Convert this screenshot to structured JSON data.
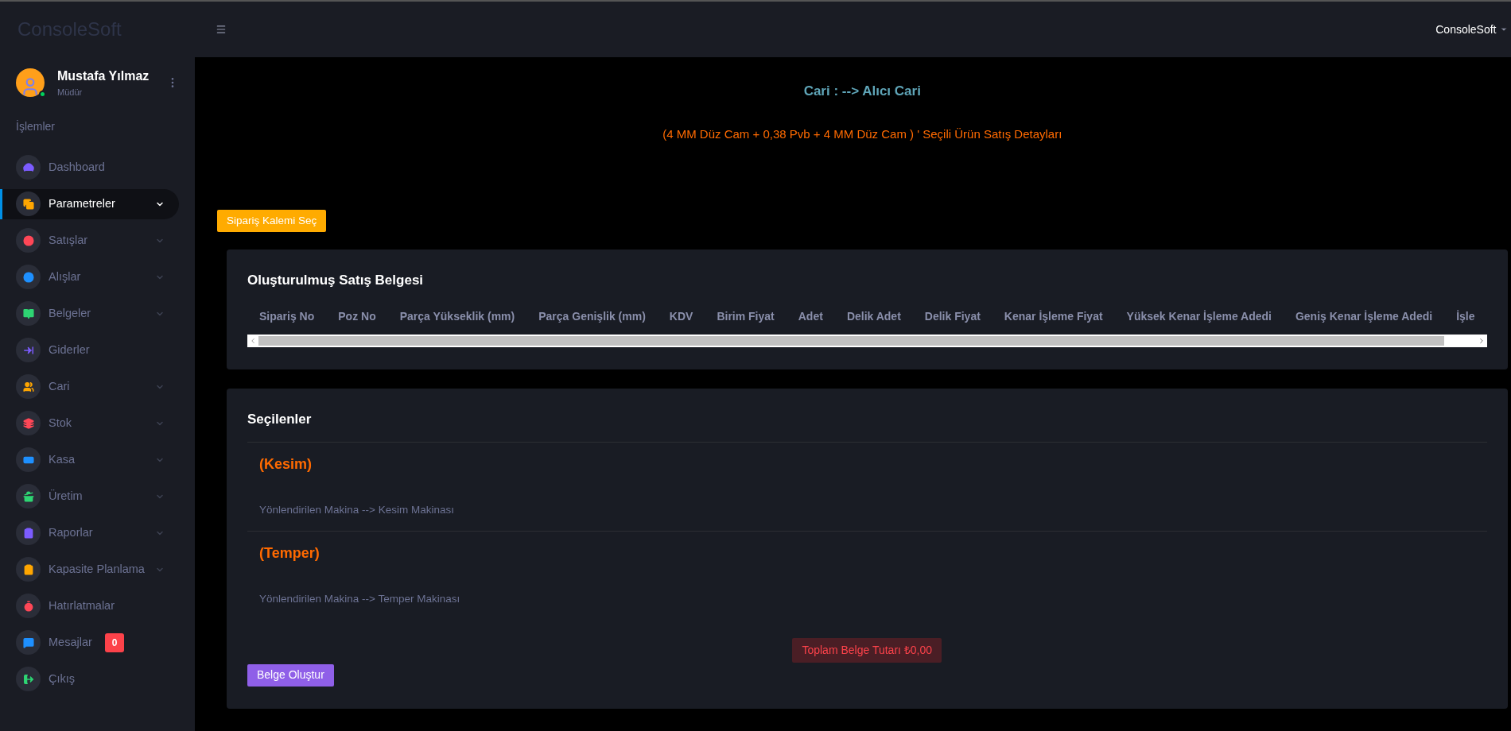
{
  "brand": "ConsoleSoft",
  "topbar": {
    "account": "ConsoleSoft"
  },
  "user": {
    "name": "Mustafa Yılmaz",
    "role": "Müdür",
    "online": true
  },
  "sidebar": {
    "heading": "İşlemler",
    "items": [
      {
        "label": "Dashboard",
        "color": "#7c5cff",
        "expandable": false,
        "selected": false
      },
      {
        "label": "Parametreler",
        "color": "#ffa600",
        "expandable": true,
        "selected": true
      },
      {
        "label": "Satışlar",
        "color": "#ff4757",
        "expandable": true,
        "selected": false
      },
      {
        "label": "Alışlar",
        "color": "#1e90ff",
        "expandable": true,
        "selected": false
      },
      {
        "label": "Belgeler",
        "color": "#2ed573",
        "expandable": true,
        "selected": false
      },
      {
        "label": "Giderler",
        "color": "#7c5cff",
        "expandable": false,
        "selected": false
      },
      {
        "label": "Cari",
        "color": "#ffa600",
        "expandable": true,
        "selected": false
      },
      {
        "label": "Stok",
        "color": "#ff4757",
        "expandable": true,
        "selected": false
      },
      {
        "label": "Kasa",
        "color": "#1e90ff",
        "expandable": true,
        "selected": false
      },
      {
        "label": "Üretim",
        "color": "#2ed573",
        "expandable": true,
        "selected": false
      },
      {
        "label": "Raporlar",
        "color": "#7c5cff",
        "expandable": true,
        "selected": false
      },
      {
        "label": "Kapasite Planlama",
        "color": "#ffa600",
        "expandable": true,
        "selected": false
      },
      {
        "label": "Hatırlatmalar",
        "color": "#ff4757",
        "expandable": false,
        "selected": false
      },
      {
        "label": "Mesajlar",
        "color": "#1e90ff",
        "expandable": false,
        "selected": false,
        "badge": "0"
      },
      {
        "label": "Çıkış",
        "color": "#2ed573",
        "expandable": false,
        "selected": false
      }
    ]
  },
  "header": {
    "title": "Cari : --> Alıcı Cari",
    "subtitle": "(4 MM Düz Cam + 0,38 Pvb + 4 MM Düz Cam ) ' Seçili Ürün Satış Detayları"
  },
  "select_button": "Sipariş Kalemi Seç",
  "document_card": {
    "title": "Oluşturulmuş Satış Belgesi",
    "columns": [
      "Sipariş No",
      "Poz No",
      "Parça Yükseklik (mm)",
      "Parça Genişlik (mm)",
      "KDV",
      "Birim Fiyat",
      "Adet",
      "Delik Adet",
      "Delik Fiyat",
      "Kenar İşleme Fiyat",
      "Yüksek Kenar İşleme Adedi",
      "Geniş Kenar İşleme Adedi",
      "İşle"
    ]
  },
  "selected_card": {
    "title": "Seçilenler",
    "items": [
      {
        "name": "(Kesim)",
        "machine": "Yönlendirilen Makina --> Kesim Makinası"
      },
      {
        "name": "(Temper)",
        "machine": "Yönlendirilen Makina --> Temper Makinası"
      }
    ],
    "total": "Toplam Belge Tutarı ₺0,00",
    "create_button": "Belge Oluştur"
  }
}
